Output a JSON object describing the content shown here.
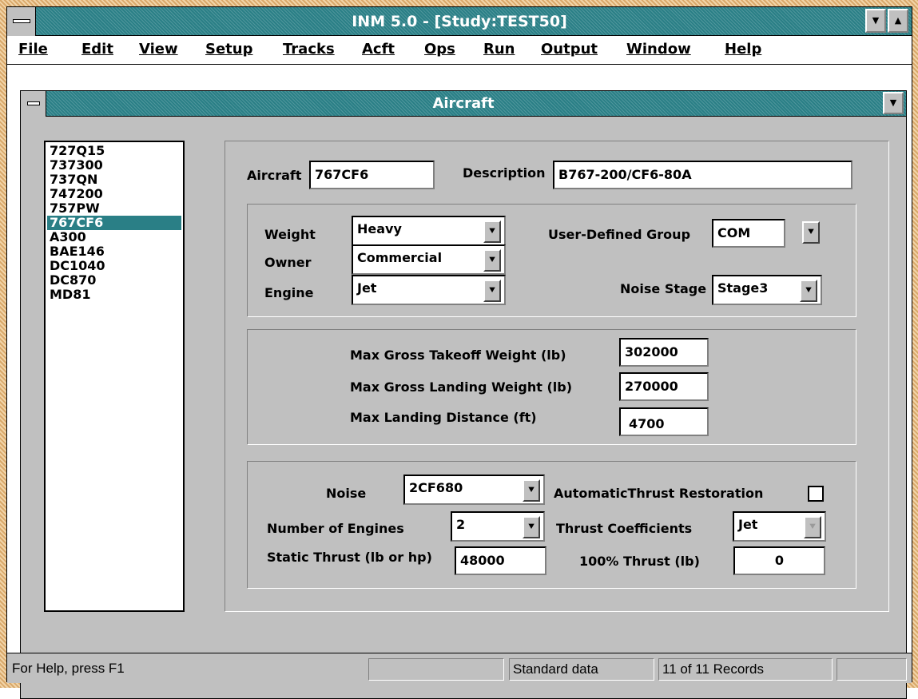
{
  "app": {
    "title": "INM 5.0 - [Study:TEST50]",
    "minimize_glyph": "▼",
    "maximize_glyph": "▲"
  },
  "menu": [
    "File",
    "Edit",
    "View",
    "Setup",
    "Tracks",
    "Acft",
    "Ops",
    "Run",
    "Output",
    "Window",
    "Help"
  ],
  "window": {
    "title": "Aircraft",
    "restore_glyph": "▼"
  },
  "aircraft_list": {
    "items": [
      "727Q15",
      "737300",
      "737QN",
      "747200",
      "757PW",
      "767CF6",
      "A300",
      "BAE146",
      "DC1040",
      "DC870",
      "MD81"
    ],
    "selected": "767CF6"
  },
  "details": {
    "aircraft_label": "Aircraft",
    "aircraft_value": "767CF6",
    "description_label": "Description",
    "description_value": "B767-200/CF6-80A"
  },
  "classification": {
    "weight_label": "Weight",
    "weight_value": "Heavy",
    "owner_label": "Owner",
    "owner_value": "Commercial",
    "engine_label": "Engine",
    "engine_value": "Jet",
    "group_label": "User-Defined Group",
    "group_value": "COM",
    "noise_stage_label": "Noise Stage",
    "noise_stage_value": "Stage3",
    "dropdown_glyph": "⯆"
  },
  "weights": {
    "takeoff_label": "Max Gross Takeoff Weight (lb)",
    "takeoff_value": "302000",
    "landing_label": "Max Gross Landing Weight (lb)",
    "landing_value": "270000",
    "distance_label": "Max Landing Distance (ft)",
    "distance_value": "4700"
  },
  "engine": {
    "noise_label": "Noise",
    "noise_value": "2CF680",
    "restoration_label": "AutomaticThrust Restoration",
    "restoration_checked": false,
    "engines_label": "Number of Engines",
    "engines_value": "2",
    "coeff_label": "Thrust Coefficients",
    "coeff_value": "Jet",
    "static_label": "Static Thrust (lb or hp)",
    "static_value": "48000",
    "full_label": "100% Thrust (lb)",
    "full_value": "0"
  },
  "status": {
    "help": "For Help, press F1",
    "data": "Standard data",
    "records": "11 of 11  Records"
  }
}
